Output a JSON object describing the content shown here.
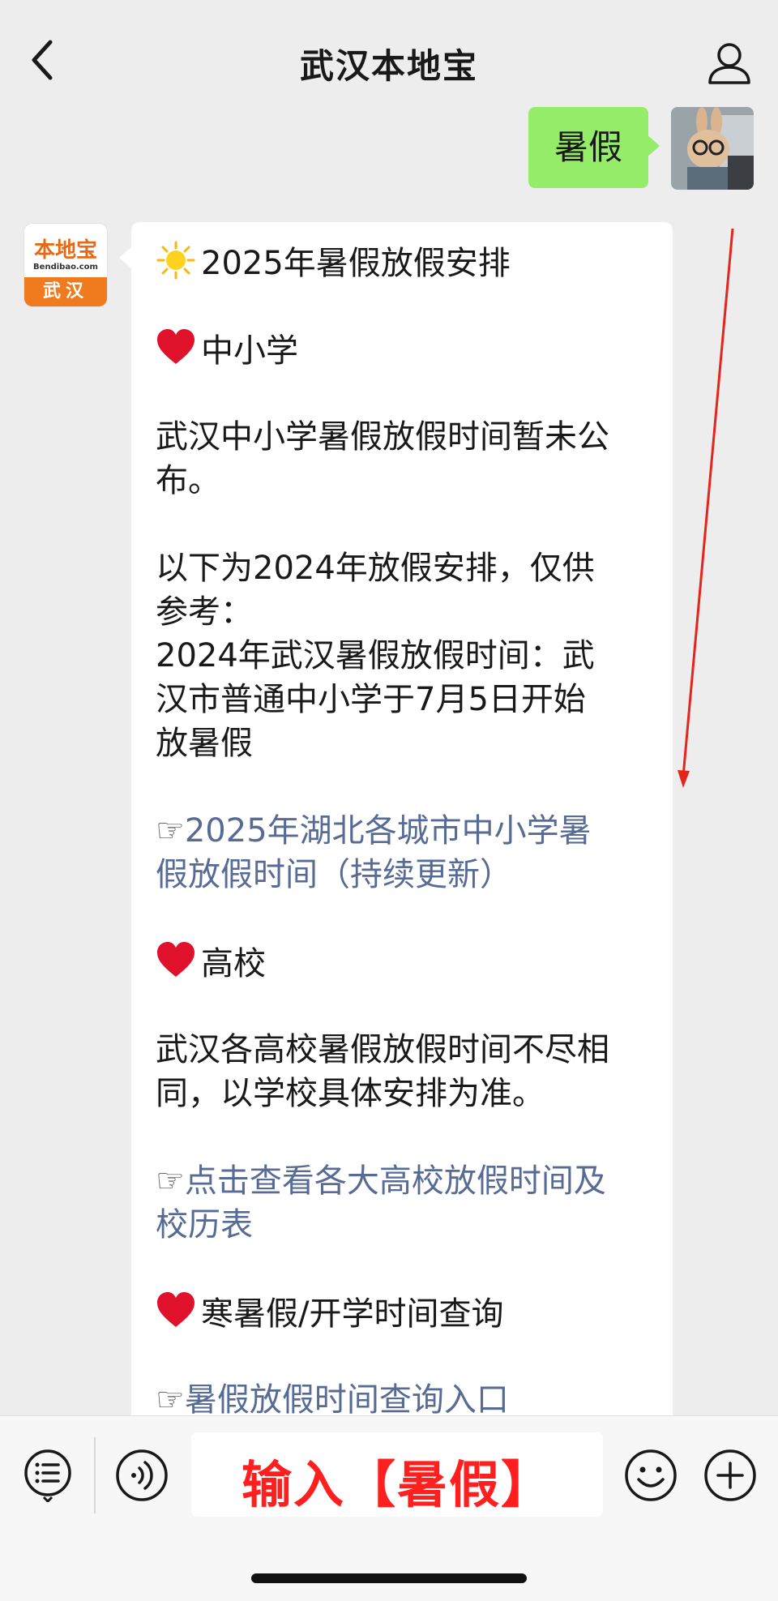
{
  "nav": {
    "title": "武汉本地宝",
    "back_icon": "chevron-left-icon",
    "profile_icon": "person-icon"
  },
  "user_message": {
    "text": "暑假"
  },
  "bot": {
    "avatar": {
      "brand": "本地宝",
      "domain": "Bendibao.com",
      "city": "武汉"
    },
    "title": "2025年暑假放假安排",
    "section_primary": "中小学",
    "primary_notice": [
      "武汉中小学暑假放假时间暂未公",
      "布。"
    ],
    "ref_intro": [
      "以下为2024年放假安排，仅供",
      "参考："
    ],
    "ref_detail": [
      "2024年武汉暑假放假时间：武",
      "汉市普通中小学于7月5日开始",
      "放暑假"
    ],
    "link_hubei": [
      "2025年湖北各城市中小学暑",
      "假放假时间（持续更新）"
    ],
    "section_college": "高校",
    "college_notice": [
      "武汉各高校暑假放假时间不尽相",
      "同，以学校具体安排为准。"
    ],
    "link_college": [
      "点击查看各大高校放假时间及",
      "校历表"
    ],
    "section_query": "寒暑假/开学时间查询",
    "link_query": "暑假放假时间查询入口"
  },
  "input_bar": {
    "overlay_text": "输入【暑假】",
    "icons": [
      "menu-icon",
      "voice-icon",
      "emoji-icon",
      "plus-icon"
    ]
  },
  "colors": {
    "bubble_user": "#95ec69",
    "link": "#576b95",
    "overlay_red": "#ff1f1f",
    "brand_orange": "#f07a1e"
  }
}
